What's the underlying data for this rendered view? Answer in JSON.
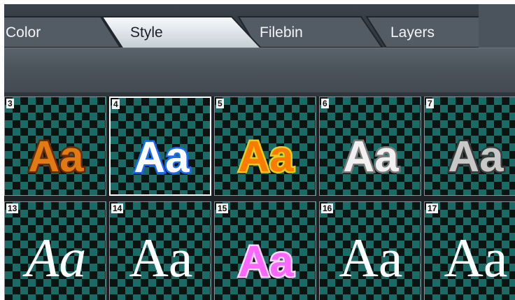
{
  "tabs": [
    {
      "label": "Color",
      "active": false
    },
    {
      "label": "Style",
      "active": true
    },
    {
      "label": "Filebin",
      "active": false
    },
    {
      "label": "Layers",
      "active": false
    }
  ],
  "styles": [
    {
      "number": "3",
      "text": "Aa",
      "fill": "#e07a12",
      "outline": "#6a2a00",
      "selected": false
    },
    {
      "number": "4",
      "text": "Aa",
      "fill": "#ffffff",
      "outline": "#1a6cff",
      "selected": true
    },
    {
      "number": "5",
      "text": "Aa",
      "fill": "#ff7a00",
      "outline": "#e8d020",
      "selected": false
    },
    {
      "number": "6",
      "text": "Aa",
      "fill": "#f0f0f0",
      "outline": "#7a7a7a",
      "selected": false
    },
    {
      "number": "7",
      "text": "Aa",
      "fill": "#c8c8c8",
      "outline": "#3a3a3a",
      "selected": false
    },
    {
      "number": "13",
      "text": "Aa",
      "fill": "#ffffff",
      "outline": "none",
      "selected": false
    },
    {
      "number": "14",
      "text": "Aa",
      "fill": "#ffffff",
      "outline": "none",
      "selected": false
    },
    {
      "number": "15",
      "text": "Aa",
      "fill": "#ff66ff",
      "outline": "#ffd6ff",
      "selected": false
    },
    {
      "number": "16",
      "text": "Aa",
      "fill": "#ffffff",
      "outline": "none",
      "selected": false
    },
    {
      "number": "17",
      "text": "Aa",
      "fill": "#ffffff",
      "outline": "none",
      "selected": false
    }
  ]
}
